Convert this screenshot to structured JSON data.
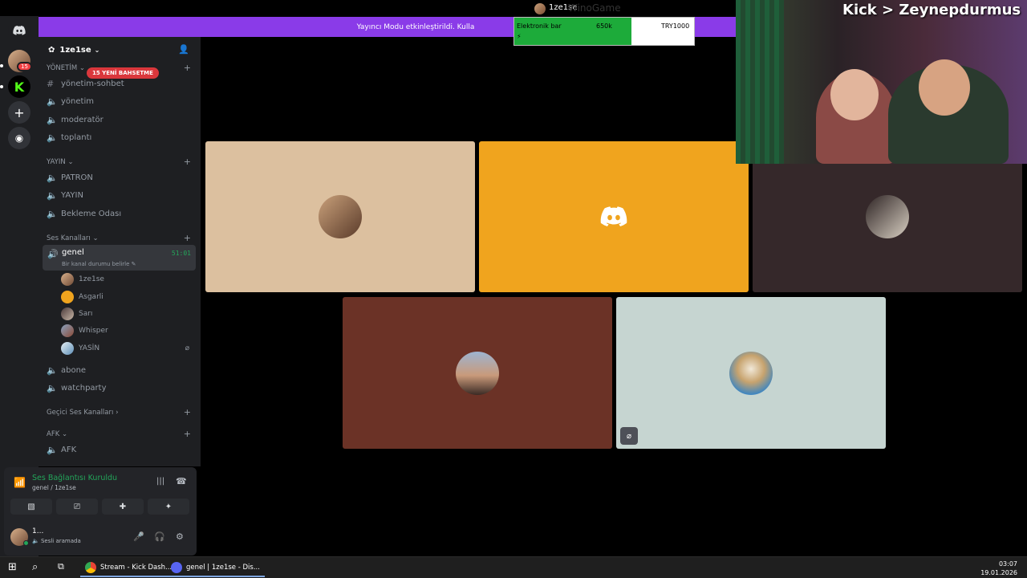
{
  "window": {
    "title_user": "1ze1se",
    "title_ghost": "WinoGame"
  },
  "banner": {
    "text": "Yayıncı Modu etkinleştirildi. Kulla"
  },
  "overlay": {
    "label": "Elektronik bar",
    "value": "650k",
    "goal": "TRY1000",
    "bolt": "⚡",
    "progress_fraction": 0.65
  },
  "cam": {
    "caption": "Kick > Zeynepdurmus"
  },
  "rail": {
    "badge": "15"
  },
  "server": {
    "name": "1ze1se"
  },
  "new_badge": "15 YENİ BAHSETME",
  "categories": {
    "yonetim": "YÖNETİM",
    "yayin": "YAYIN",
    "ses": "Ses Kanalları",
    "gecici": "Geçici Ses Kanalları",
    "afk": "AFK"
  },
  "channels": {
    "yonetim_sohbet": "yönetim-sohbet",
    "yonetim": "yönetim",
    "moderator": "moderatör",
    "toplanti": "toplantı",
    "patron": "PATRON",
    "yayin": "YAYIN",
    "bekleme": "Bekleme Odası",
    "genel": "genel",
    "genel_time": "51:01",
    "genel_status": "Bir kanal durumu belirle",
    "abone": "abone",
    "watchparty": "watchparty",
    "afk": "AFK"
  },
  "voice_users": [
    "1ze1se",
    "Asgarli",
    "Sarı",
    "Whisper",
    "YASİN"
  ],
  "voice_panel": {
    "title": "Ses Bağlantısı Kuruldu",
    "subtitle": "genel / 1ze1se",
    "user_name": "1...",
    "user_status": "Sesli aramada"
  },
  "taskbar": {
    "app1": "Stream - Kick Dash...",
    "app2": "genel | 1ze1se - Dis...",
    "time": "03:07",
    "date": "19.01.2026"
  },
  "colors": {
    "tile1": "#dcc09f",
    "tile2": "#f0a41e",
    "tile3": "#35282a",
    "tile4": "#6b3226",
    "tile5": "#c6d5d1",
    "accent_green": "#23a55a",
    "banner_purple": "#8a3be8"
  }
}
